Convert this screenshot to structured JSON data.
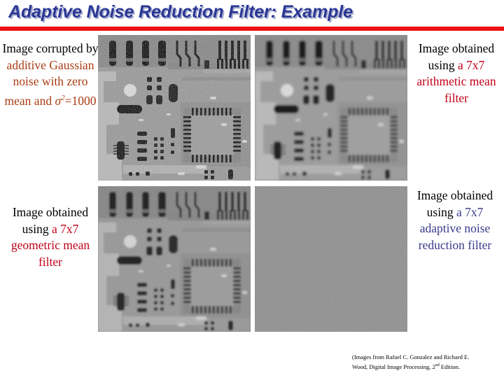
{
  "title": {
    "text": "Adaptive Noise Reduction Filter: Example",
    "color": "#2a3795",
    "shadow_color": "#a8aecd",
    "rule_color": "#ee1111"
  },
  "captions": {
    "top_left": {
      "lead": "Image corrupted by ",
      "highlight": "additive Gaussian noise with zero mean and ",
      "sigma": "σ",
      "sigma_exponent": "2",
      "sigma_value": "=1000",
      "highlight_color": "#a83c14",
      "full_text": "Image corrupted by additive Gaussian noise with zero mean and σ²=1000"
    },
    "top_right": {
      "lead": "Image obtained using ",
      "highlight": "a 7x7 arithmetic mean filter",
      "highlight_color": "#c00018",
      "full_text": "Image obtained using a 7x7 arithmetic mean filter"
    },
    "bottom_left": {
      "lead": "Image obtained using ",
      "highlight": "a 7x7 geometric mean filter",
      "highlight_color": "#c00018",
      "full_text": "Image obtained using a 7x7 geometric mean filter"
    },
    "bottom_right": {
      "lead": "Image obtained using ",
      "highlight": "a 7x7 adaptive noise reduction filter",
      "highlight_color": "#3a3a8c",
      "full_text": "Image obtained using a 7x7 adaptive noise reduction filter"
    }
  },
  "images": {
    "subject": "printed circuit board close-up",
    "panels": [
      {
        "position": "top-left",
        "label": "noisy-original",
        "name": "pcb-image-noisy"
      },
      {
        "position": "top-right",
        "label": "arithmetic-mean-7x7",
        "name": "pcb-image-arithmetic-mean"
      },
      {
        "position": "bottom-left",
        "label": "geometric-mean-7x7",
        "name": "pcb-image-geometric-mean"
      },
      {
        "position": "bottom-right",
        "label": "adaptive-noise-reduction",
        "name": "pcb-image-adaptive"
      }
    ]
  },
  "credit": {
    "line1": "(Images from Rafael C. Gonzalez and Richard E.",
    "line2_a": "Wood, Digital Image Processing, 2",
    "line2_sup": "nd",
    "line2_b": " Edition."
  }
}
